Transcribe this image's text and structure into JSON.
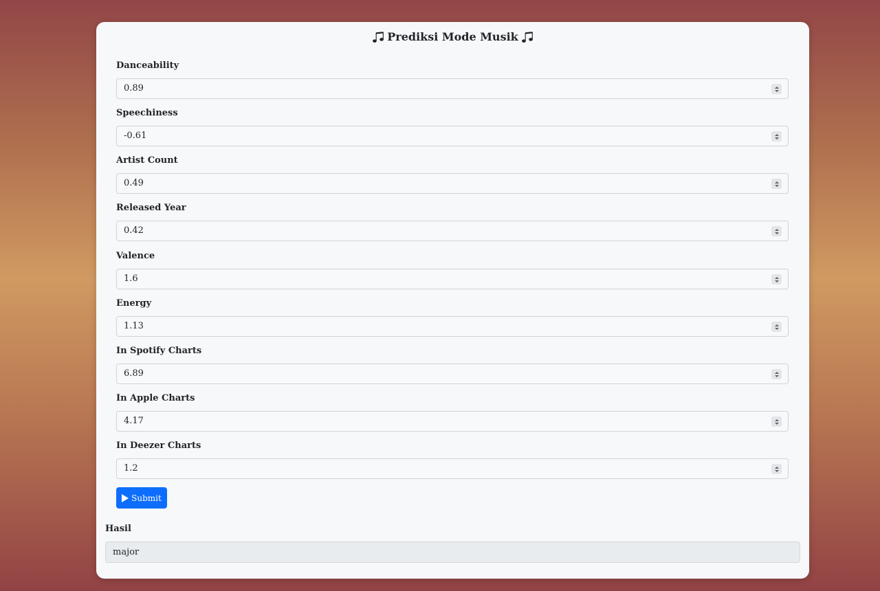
{
  "form": {
    "title": "Prediksi Mode Musik",
    "fields": [
      {
        "label": "Danceability",
        "value": "0.89"
      },
      {
        "label": "Speechiness",
        "value": "-0.61"
      },
      {
        "label": "Artist Count",
        "value": "0.49"
      },
      {
        "label": "Released Year",
        "value": "0.42"
      },
      {
        "label": "Valence",
        "value": "1.6"
      },
      {
        "label": "Energy",
        "value": "1.13"
      },
      {
        "label": "In Spotify Charts",
        "value": "6.89"
      },
      {
        "label": "In Apple Charts",
        "value": "4.17"
      },
      {
        "label": "In Deezer Charts",
        "value": "1.2"
      }
    ],
    "submit_label": "Submit"
  },
  "result": {
    "label": "Hasil",
    "value": "major"
  },
  "colors": {
    "primary": "#0d6efd",
    "card_background": "#f7f8fa",
    "output_background": "#e9ecef"
  },
  "icons": {
    "title_left": "music-note-icon",
    "title_right": "music-note-icon",
    "submit": "play-icon"
  }
}
